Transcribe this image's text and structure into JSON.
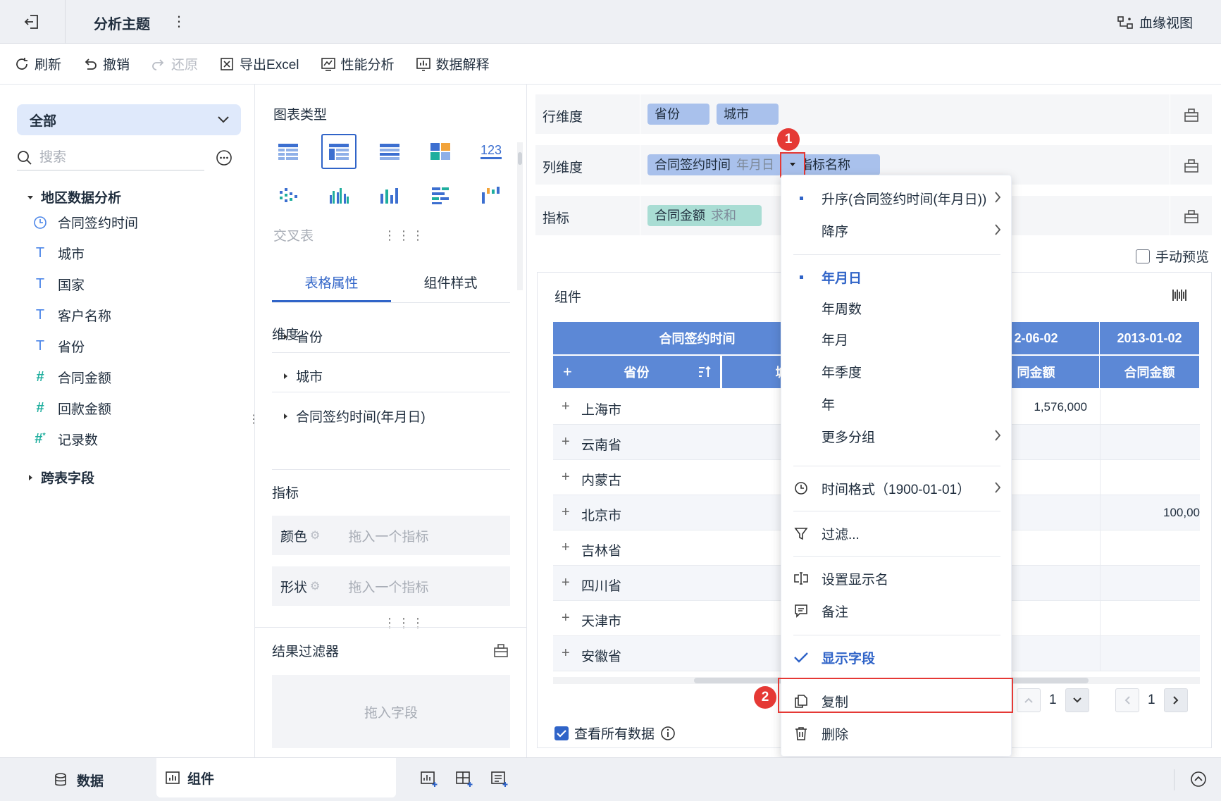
{
  "topbar": {
    "subject_title": "分析主题",
    "more": "⋮",
    "lineage_label": "血缘视图"
  },
  "toolbar": {
    "refresh": "刷新",
    "undo": "撤销",
    "redo": "还原",
    "export_excel": "导出Excel",
    "perf_analysis": "性能分析",
    "data_explain": "数据解释"
  },
  "left": {
    "category": "全部",
    "search_placeholder": "搜索",
    "group_name": "地区数据分析",
    "fields": [
      {
        "name": "合同签约时间",
        "type": "time"
      },
      {
        "name": "城市",
        "type": "text"
      },
      {
        "name": "国家",
        "type": "text"
      },
      {
        "name": "客户名称",
        "type": "text"
      },
      {
        "name": "省份",
        "type": "text"
      },
      {
        "name": "合同金额",
        "type": "number"
      },
      {
        "name": "回款金额",
        "type": "number"
      },
      {
        "name": "记录数",
        "type": "number-calc"
      }
    ],
    "cross_table_fields": "跨表字段"
  },
  "middle": {
    "chart_type_label": "图表类型",
    "crosstab_label": "交叉表",
    "tabs": [
      "表格属性",
      "组件样式"
    ],
    "dimension_label": "维度",
    "dimensions": [
      "省份",
      "城市",
      "合同签约时间(年月日)"
    ],
    "metric_label": "指标",
    "color_label": "颜色",
    "shape_label": "形状",
    "drop_metric_placeholder": "拖入一个指标",
    "result_filter": "结果过滤器",
    "drop_field_placeholder": "拖入字段"
  },
  "right": {
    "row_dim_label": "行维度",
    "row_chips": [
      "省份",
      "城市"
    ],
    "col_dim_label": "列维度",
    "col_chip_main": "合同签约时间",
    "col_chip_sub": "年月日",
    "col_chip2": "指标名称",
    "metric_label": "指标",
    "metric_chip": "合同金额",
    "metric_chip_sub": "求和",
    "manual_preview": "手动预览",
    "component_label": "组件",
    "badge1": "1",
    "badge2": "2"
  },
  "table": {
    "header_time": "合同签约时间",
    "header_date1": "2-06-02",
    "header_date2": "2013-01-02",
    "col_province": "省份",
    "col_city": "城",
    "col_amount1": "同金额",
    "col_amount2": "合同金额",
    "rows": [
      {
        "province": "上海市",
        "v1": "1,576,000",
        "v2": ""
      },
      {
        "province": "云南省",
        "v1": "",
        "v2": ""
      },
      {
        "province": "内蒙古",
        "v1": "",
        "v2": ""
      },
      {
        "province": "北京市",
        "v1": "",
        "v2": "100,00"
      },
      {
        "province": "吉林省",
        "v1": "",
        "v2": ""
      },
      {
        "province": "四川省",
        "v1": "",
        "v2": ""
      },
      {
        "province": "天津市",
        "v1": "",
        "v2": ""
      },
      {
        "province": "安徽省",
        "v1": "",
        "v2": ""
      }
    ],
    "page1": "1",
    "page2": "1",
    "view_all": "查看所有数据"
  },
  "menu": {
    "sort_asc": "升序(合同签约时间(年月日))",
    "sort_desc": "降序",
    "g_ymd": "年月日",
    "g_yw": "年周数",
    "g_ym": "年月",
    "g_yq": "年季度",
    "g_y": "年",
    "more_groups": "更多分组",
    "time_format": "时间格式（1900-01-01）",
    "filter": "过滤...",
    "set_display_name": "设置显示名",
    "note": "备注",
    "show_field": "显示字段",
    "copy": "复制",
    "delete": "删除"
  },
  "bottombar": {
    "data_tab": "数据",
    "component_tab": "组件"
  },
  "colors": {
    "accent": "#3064c8",
    "table_header": "#5c88d6",
    "chip_blue": "#a9c1ec",
    "chip_green": "#a9ddd4",
    "highlight_red": "#e53935"
  }
}
